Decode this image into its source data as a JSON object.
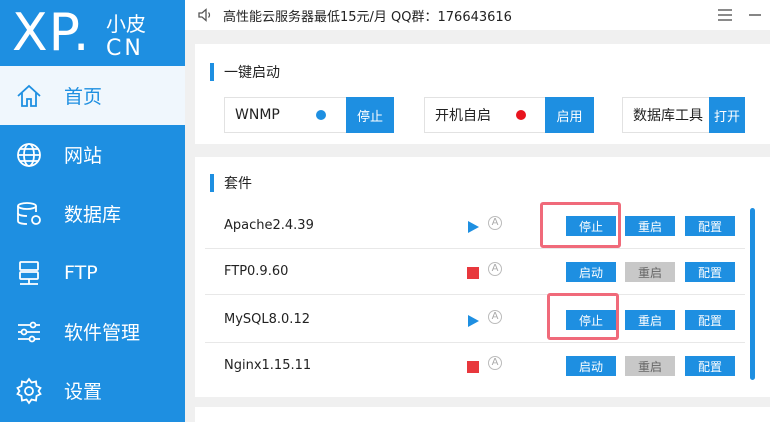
{
  "app": {
    "logo_main": "XP.",
    "logo_sub_top": "小皮",
    "logo_sub_bottom": "CN"
  },
  "topbar": {
    "notice": "高性能云服务器最低15元/月  QQ群：176643616"
  },
  "sidebar": {
    "items": [
      {
        "label": "首页",
        "icon": "home-icon",
        "active": true
      },
      {
        "label": "网站",
        "icon": "globe-icon"
      },
      {
        "label": "数据库",
        "icon": "database-icon"
      },
      {
        "label": "FTP",
        "icon": "ftp-icon"
      },
      {
        "label": "软件管理",
        "icon": "sliders-icon"
      },
      {
        "label": "设置",
        "icon": "gear-icon"
      }
    ]
  },
  "quickstart": {
    "title": "一键启动",
    "groups": [
      {
        "label": "WNMP",
        "button": "停止",
        "dot_color": "#1e8fe1"
      },
      {
        "label": "开机自启",
        "button": "启用",
        "dot_color": "#e8141e"
      },
      {
        "label": "数据库工具",
        "button": "打开"
      }
    ]
  },
  "suite": {
    "title": "套件",
    "rows": [
      {
        "name": "Apache2.4.39",
        "status": "running",
        "action": "停止",
        "restart": "重启",
        "config": "配置"
      },
      {
        "name": "FTP0.9.60",
        "status": "stopped",
        "action": "启动",
        "restart": "重启",
        "config": "配置"
      },
      {
        "name": "MySQL8.0.12",
        "status": "running",
        "action": "停止",
        "restart": "重启",
        "config": "配置"
      },
      {
        "name": "Nginx1.15.11",
        "status": "stopped",
        "action": "启动",
        "restart": "重启",
        "config": "配置"
      }
    ],
    "auto_glyph": "A"
  },
  "colors": {
    "accent": "#1e8fe1",
    "running": "#1e8fe1",
    "stopped": "#e8383d",
    "highlight": "#f06a7a"
  }
}
